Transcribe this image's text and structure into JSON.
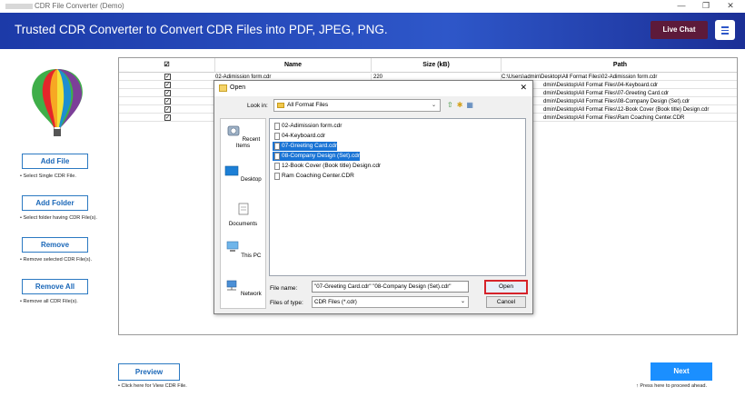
{
  "window": {
    "title": "CDR File Converter (Demo)",
    "controls": [
      "—",
      "❐",
      "✕"
    ]
  },
  "banner": {
    "title": "Trusted CDR Converter to Convert CDR Files into PDF, JPEG, PNG.",
    "live_chat": "Live Chat"
  },
  "sidebar": {
    "add_file": {
      "label": "Add File",
      "hint": "• Select Single CDR File."
    },
    "add_folder": {
      "label": "Add Folder",
      "hint": "• Select folder having CDR File(s)."
    },
    "remove": {
      "label": "Remove",
      "hint": "• Remove selected CDR File(s)."
    },
    "remove_all": {
      "label": "Remove All",
      "hint": "• Remove all CDR File(s)."
    }
  },
  "table": {
    "columns": {
      "check": "☑",
      "name": "Name",
      "size": "Size (kB)",
      "path": "Path"
    },
    "rows": [
      {
        "name": "02-Adimission form.cdr",
        "size": "220",
        "path": "C:\\Users\\admin\\Desktop\\All Format Files\\02-Adimission form.cdr"
      },
      {
        "name": "",
        "size": "",
        "path": "dmin\\Desktop\\All Format Files\\04-Keyboard.cdr"
      },
      {
        "name": "",
        "size": "",
        "path": "dmin\\Desktop\\All Format Files\\07-Greeting Card.cdr"
      },
      {
        "name": "",
        "size": "",
        "path": "dmin\\Desktop\\All Format Files\\08-Company Design (Set).cdr"
      },
      {
        "name": "",
        "size": "",
        "path": "dmin\\Desktop\\All Format Files\\12-Book Cover (Book title) Design.cdr"
      },
      {
        "name": "",
        "size": "",
        "path": "dmin\\Desktop\\All Format Files\\Ram Coaching Center.CDR"
      }
    ]
  },
  "footer": {
    "preview": {
      "label": "Preview",
      "hint": "• Click here for View CDR File."
    },
    "next": {
      "label": "Next",
      "hint": "↑ Press here to proceed ahead."
    }
  },
  "dialog": {
    "title": "Open",
    "look_in_label": "Look in:",
    "look_in_value": "All Format Files",
    "places": [
      "Recent Items",
      "Desktop",
      "Documents",
      "This PC",
      "Network"
    ],
    "files": [
      {
        "name": "02-Adimission form.cdr",
        "selected": false
      },
      {
        "name": "04-Keyboard.cdr",
        "selected": false
      },
      {
        "name": "07-Greeting Card.cdr",
        "selected": true
      },
      {
        "name": "08-Company Design (Set).cdr",
        "selected": true
      },
      {
        "name": "12-Book Cover (Book title) Design.cdr",
        "selected": false
      },
      {
        "name": "Ram Coaching Center.CDR",
        "selected": false
      }
    ],
    "file_name_label": "File name:",
    "file_name_value": "\"07-Greeting Card.cdr\" \"08-Company Design (Set).cdr\"",
    "file_type_label": "Files of type:",
    "file_type_value": "CDR Files (*.cdr)",
    "open_label": "Open",
    "cancel_label": "Cancel"
  }
}
